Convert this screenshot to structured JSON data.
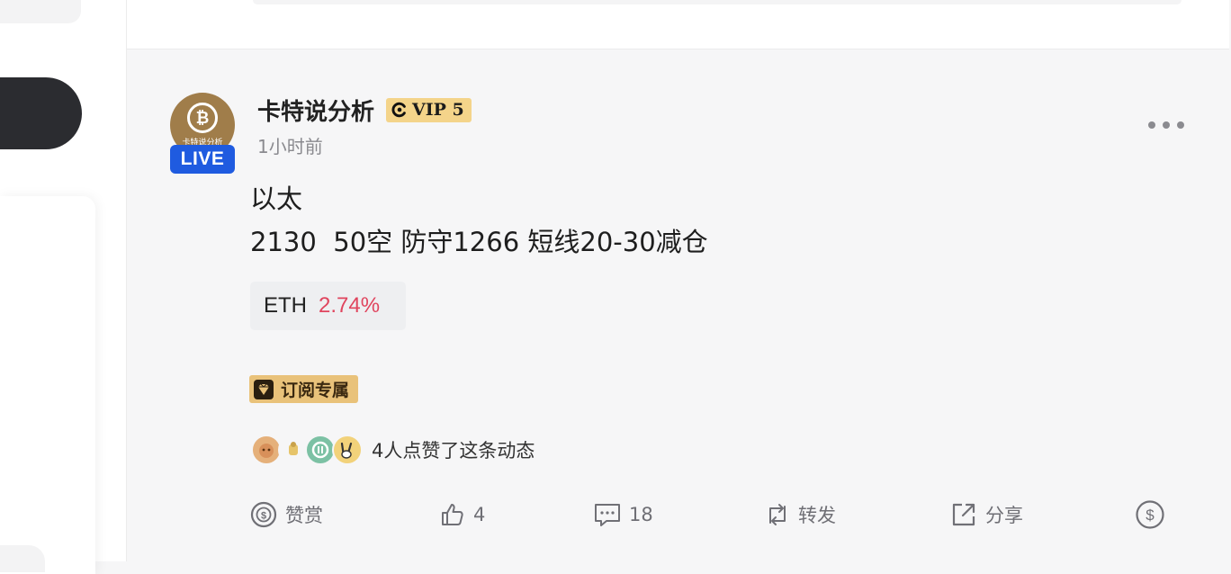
{
  "post": {
    "author": "卡特说分析",
    "vip_label": "VIP 5",
    "live_label": "LIVE",
    "avatar_caption": "卡特说分析",
    "time": "1小时前",
    "content_lines": [
      "以太",
      "2130  50空 防守1266 短线20-30减仓"
    ],
    "ticker": {
      "symbol": "ETH",
      "change": "2.74%"
    },
    "subscription_badge": "订阅专属",
    "likers_text": "4人点赞了这条动态"
  },
  "actions": {
    "tip_label": "赞赏",
    "like_count": "4",
    "comment_count": "18",
    "repost_label": "转发",
    "share_label": "分享"
  },
  "colors": {
    "live_badge": "#1f5be0",
    "vip_badge": "#f4d48a",
    "price_change": "#e0455e",
    "subscription_badge": "#e9c27a"
  },
  "icons": [
    "more-icon",
    "vip-icon",
    "diamond-icon",
    "tip-coin-icon",
    "thumbs-up-icon",
    "comment-icon",
    "repost-icon",
    "share-icon",
    "dollar-icon"
  ]
}
